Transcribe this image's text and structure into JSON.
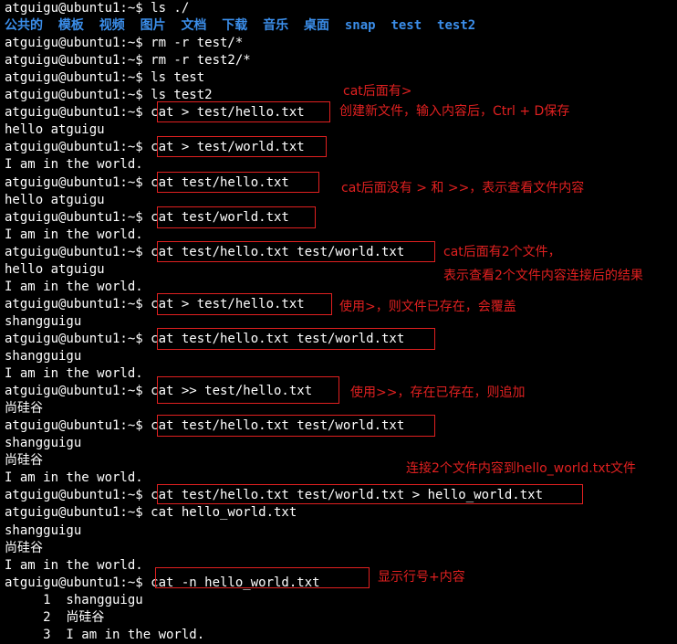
{
  "prompt": "atguigu@ubuntu1:~$ ",
  "ls_items": [
    "公共的",
    "模板",
    "视频",
    "图片",
    "文档",
    "下载",
    "音乐",
    "桌面",
    "snap",
    "test",
    "test2"
  ],
  "colors": {
    "background": "#000000",
    "text": "#ffffff",
    "dir": "#3b8eea",
    "annotation": "#e02020"
  },
  "lines": [
    {
      "text": "atguigu@ubuntu1:~$ ls ./"
    },
    {
      "ls": true
    },
    {
      "text": "atguigu@ubuntu1:~$ rm -r test/*"
    },
    {
      "text": "atguigu@ubuntu1:~$ rm -r test2/*"
    },
    {
      "text": "atguigu@ubuntu1:~$ ls test"
    },
    {
      "text": "atguigu@ubuntu1:~$ ls test2"
    },
    {
      "text": "atguigu@ubuntu1:~$ cat > test/hello.txt"
    },
    {
      "text": "hello atguigu"
    },
    {
      "text": "atguigu@ubuntu1:~$ cat > test/world.txt"
    },
    {
      "text": "I am in the world."
    },
    {
      "text": "atguigu@ubuntu1:~$ cat test/hello.txt"
    },
    {
      "text": "hello atguigu"
    },
    {
      "text": "atguigu@ubuntu1:~$ cat test/world.txt"
    },
    {
      "text": "I am in the world."
    },
    {
      "text": "atguigu@ubuntu1:~$ cat test/hello.txt test/world.txt"
    },
    {
      "text": "hello atguigu"
    },
    {
      "text": "I am in the world."
    },
    {
      "text": "atguigu@ubuntu1:~$ cat > test/hello.txt"
    },
    {
      "text": "shangguigu"
    },
    {
      "text": "atguigu@ubuntu1:~$ cat test/hello.txt test/world.txt"
    },
    {
      "text": "shangguigu"
    },
    {
      "text": "I am in the world."
    },
    {
      "text": "atguigu@ubuntu1:~$ cat >> test/hello.txt"
    },
    {
      "text": "尚硅谷"
    },
    {
      "text": "atguigu@ubuntu1:~$ cat test/hello.txt test/world.txt"
    },
    {
      "text": "shangguigu"
    },
    {
      "text": "尚硅谷"
    },
    {
      "text": "I am in the world."
    },
    {
      "text": "atguigu@ubuntu1:~$ cat test/hello.txt test/world.txt > hello_world.txt"
    },
    {
      "text": "atguigu@ubuntu1:~$ cat hello_world.txt"
    },
    {
      "text": "shangguigu"
    },
    {
      "text": "尚硅谷"
    },
    {
      "text": "I am in the world."
    },
    {
      "text": "atguigu@ubuntu1:~$ cat -n hello_world.txt"
    },
    {
      "text": "     1  shangguigu"
    },
    {
      "text": "     2  尚硅谷"
    },
    {
      "text": "     3  I am in the world."
    }
  ],
  "annotations": {
    "a1": "cat后面有>",
    "a2": "创建新文件，输入内容后，Ctrl + D保存",
    "a3": "cat后面没有 > 和 >>，表示查看文件内容",
    "a4": "cat后面有2个文件，",
    "a5": "表示查看2个文件内容连接后的结果",
    "a6": "使用>，则文件已存在，会覆盖",
    "a7": "使用>>，存在已存在，则追加",
    "a8": "连接2个文件内容到hello_world.txt文件",
    "a9": "显示行号+内容"
  }
}
